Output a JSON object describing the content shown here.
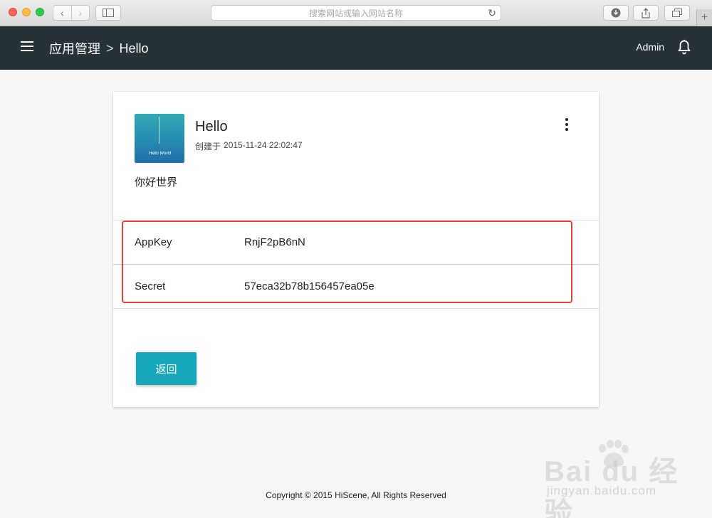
{
  "browser": {
    "url_placeholder": "搜索网站或输入网站名称",
    "newtab_label": "+"
  },
  "header": {
    "breadcrumb_root": "应用管理",
    "breadcrumb_sep": ">",
    "breadcrumb_current": "Hello",
    "user": "Admin"
  },
  "app": {
    "name": "Hello",
    "created_label": "创建于",
    "created_at": "2015-11-24 22:02:47",
    "description": "你好世界",
    "thumbnail_caption": "Hello World"
  },
  "credentials": [
    {
      "key": "AppKey",
      "value": "RnjF2pB6nN"
    },
    {
      "key": "Secret",
      "value": "57eca32b78b156457ea05e"
    }
  ],
  "actions": {
    "back_label": "返回"
  },
  "footer": {
    "copyright": "Copyright © 2015 HiScene, All Rights Reserved"
  },
  "watermark": {
    "brand": "Bai du 经验",
    "url": "jingyan.baidu.com"
  },
  "colors": {
    "appbar": "#263238",
    "accent": "#17a9bb",
    "highlight": "#e8413a"
  }
}
